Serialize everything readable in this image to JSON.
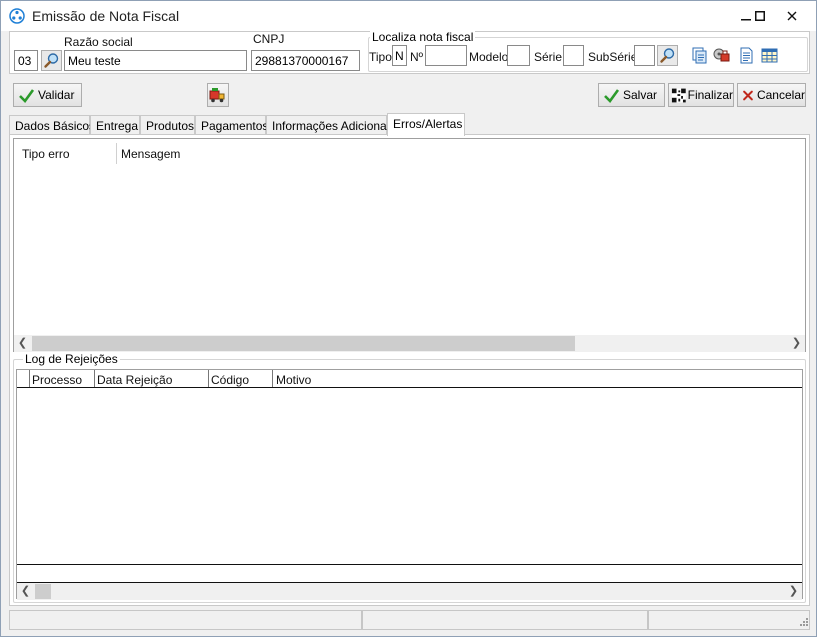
{
  "window": {
    "title": "Emissão de Nota Fiscal"
  },
  "header": {
    "razao_social_label": "Razão social",
    "cnpj_label": "CNPJ",
    "code_value": "03",
    "razao_social_value": "Meu teste",
    "cnpj_value": "29881370000167",
    "localiza": {
      "title": "Localiza nota fiscal",
      "tipo_label": "Tipo",
      "tipo_value": "N",
      "numero_label": "Nº",
      "numero_value": "",
      "modelo_label": "Modelo",
      "modelo_value": "",
      "serie_label": "Série",
      "serie_value": "",
      "subserie_label": "SubSérie",
      "subserie_value": ""
    }
  },
  "toolbar": {
    "validar_label": "Validar",
    "salvar_label": "Salvar",
    "finalizar_label": "Finalizar",
    "cancelar_label": "Cancelar"
  },
  "tabs": [
    {
      "label": "Dados Básicos"
    },
    {
      "label": "Entrega"
    },
    {
      "label": "Produtos"
    },
    {
      "label": "Pagamentos"
    },
    {
      "label": "Informações Adicionais"
    },
    {
      "label": "Erros/Alertas"
    }
  ],
  "active_tab": "Erros/Alertas",
  "errors_grid": {
    "columns": [
      "Tipo erro",
      "Mensagem"
    ]
  },
  "rejections": {
    "title": "Log de Rejeições",
    "columns": [
      "Processo",
      "Data Rejeição",
      "Código",
      "Motivo"
    ]
  },
  "colors": {
    "accent": "#1e7fd6",
    "check_green": "#2b9a2b",
    "cancel_red": "#c0281c"
  }
}
